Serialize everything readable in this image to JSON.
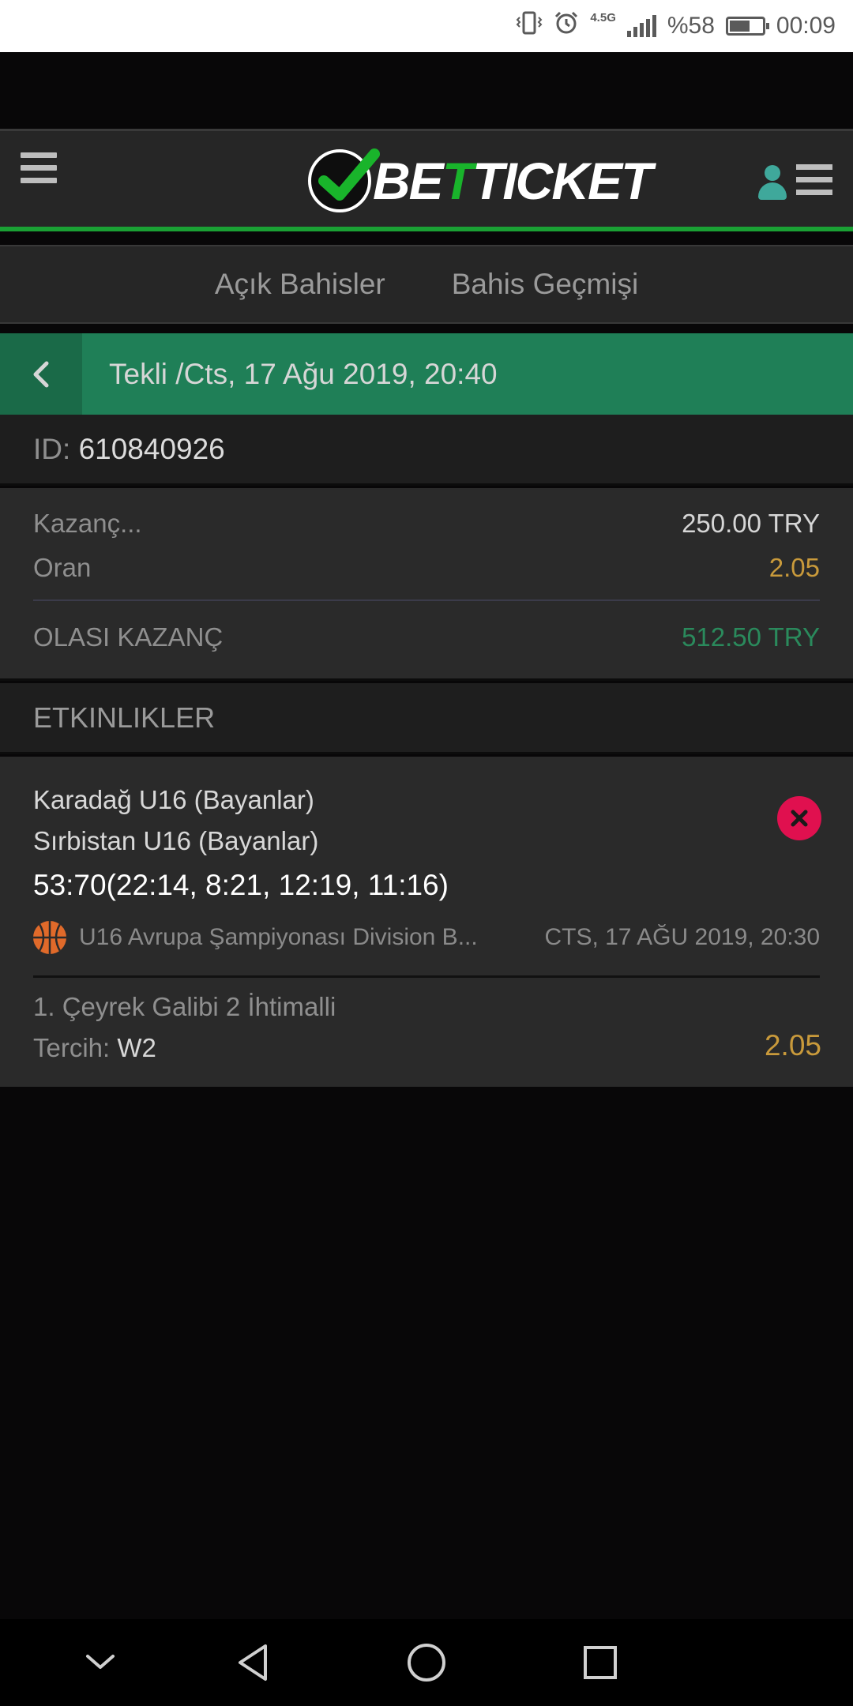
{
  "status_bar": {
    "network": "4.5G",
    "battery": "%58",
    "battery_level": 0.58,
    "time": "00:09",
    "icons": [
      "vibrate-icon",
      "alarm-icon",
      "signal-icon",
      "battery-icon"
    ]
  },
  "header": {
    "logo_part1": "BE",
    "logo_part2": "T",
    "logo_part3": "TICKET",
    "icons": [
      "hamburger-menu-icon",
      "logo-check-icon",
      "user-icon",
      "menu-icon"
    ],
    "accent": "#1aa034"
  },
  "tabs": [
    {
      "label": "Açık Bahisler"
    },
    {
      "label": "Bahis Geçmişi"
    }
  ],
  "bet": {
    "title": "Tekli /Cts, 17 Ağu 2019, 20:40",
    "id_label": "ID:",
    "id_value": "610840926",
    "stake_label": "Kazanç...",
    "stake_value": "250.00 TRY",
    "odds_label": "Oran",
    "odds_value": "2.05",
    "potential_label": "OLASI KAZANÇ",
    "potential_value": "512.50 TRY",
    "bar_color": "#1f7f57"
  },
  "events": {
    "header": "ETKINLIKLER",
    "items": [
      {
        "home": "Karadağ U16 (Bayanlar)",
        "away": "Sırbistan U16 (Bayanlar)",
        "score": "53:70(22:14, 8:21, 12:19, 11:16)",
        "league": "U16 Avrupa Şampiyonası Division B...",
        "datetime": "CTS, 17 AĞU 2019, 20:30",
        "market": "1. Çeyrek Galibi 2 İhtimalli",
        "choice_label": "Tercih:",
        "choice_value": "W2",
        "odd": "2.05",
        "sport_icon": "basketball-icon",
        "remove_icon": "close-icon"
      }
    ]
  },
  "nav": {
    "icons": [
      "nav-down-icon",
      "nav-back-icon",
      "nav-home-icon",
      "nav-recents-icon"
    ]
  }
}
